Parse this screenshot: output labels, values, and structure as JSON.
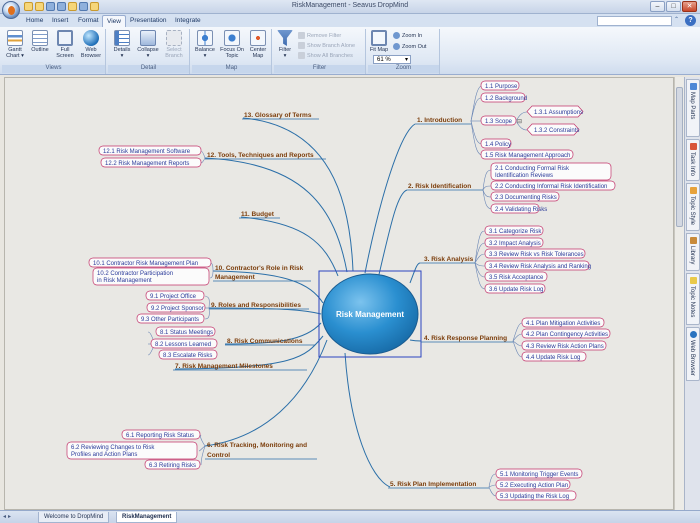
{
  "window": {
    "title": "RiskManagement - Seavus DropMind",
    "minimize": "–",
    "maximize": "□",
    "close": "✕"
  },
  "menu": {
    "tabs": [
      "Home",
      "Insert",
      "Format",
      "View",
      "Presentation",
      "Integrate"
    ],
    "active_tab": "View",
    "help": "?"
  },
  "ribbon": {
    "groups": {
      "views": {
        "label": "Views",
        "buttons": [
          {
            "label": "Gantt\nChart ▾",
            "icon": "gantt-chart-icon"
          },
          {
            "label": "Outline",
            "icon": "outline-icon"
          },
          {
            "label": "Full\nScreen",
            "icon": "full-screen-icon"
          },
          {
            "label": "Web\nBrowser",
            "icon": "web-browser-icon"
          }
        ]
      },
      "detail": {
        "label": "Detail",
        "buttons": [
          {
            "label": "Details\n▾",
            "icon": "details-icon",
            "disabled": false
          },
          {
            "label": "Collapse\n▾",
            "icon": "collapse-icon",
            "disabled": false
          },
          {
            "label": "Select\nBranch",
            "icon": "select-branch-icon",
            "disabled": true
          }
        ]
      },
      "map": {
        "label": "Map",
        "buttons": [
          {
            "label": "Balance\n▾",
            "icon": "balance-icon"
          },
          {
            "label": "Focus On\nTopic",
            "icon": "focus-on-topic-icon"
          },
          {
            "label": "Center\nMap",
            "icon": "center-map-icon"
          }
        ]
      },
      "filter": {
        "label": "Filter",
        "button": {
          "label": "Filter\n▾",
          "icon": "filter-icon"
        },
        "items": [
          "Remove Filter",
          "Show Branch Alone",
          "Show All Branches"
        ]
      },
      "zoom": {
        "label": "Zoom",
        "fit_map": "Fit Map",
        "zoom_in": "Zoom In",
        "zoom_out": "Zoom Out",
        "zoom_value": "61 %"
      }
    }
  },
  "mindmap": {
    "central": "Risk Management",
    "branches": [
      {
        "label": "1. Introduction",
        "children": [
          "1.1 Purpose",
          "1.2 Background",
          "1.3 Scope",
          "1.4 Policy",
          "1.5 Risk Management Approach"
        ],
        "subchildren": [
          "1.3.1 Assumptions",
          "1.3.2 Constraints"
        ]
      },
      {
        "label": "2. Risk Identification",
        "children": [
          "2.1 Conducting Formal Risk Identification Reviews",
          "2.2 Conducting Informal Risk Identification",
          "2.3 Documenting Risks",
          "2.4 Validating Risks"
        ]
      },
      {
        "label": "3. Risk Analysis",
        "children": [
          "3.1 Categorize Risk",
          "3.2 Impact Analysis",
          "3.3 Review Risk vs Risk Tolerances",
          "3.4 Review Risk Analysis and Ranking",
          "3.5 Risk Acceptance",
          "3.6 Update Risk Log"
        ]
      },
      {
        "label": "4. Risk Response Planning",
        "children": [
          "4.1 Plan Mitigation Activities",
          "4.2 Plan Contingency Activities",
          "4.3 Review Risk Action Plans",
          "4.4 Update Risk Log"
        ]
      },
      {
        "label": "5. Risk Plan Implementation",
        "children": [
          "5.1 Monitoring Trigger Events",
          "5.2 Executing Action Plan",
          "5.3 Updating the Risk Log"
        ]
      },
      {
        "label": "6. Risk Tracking, Monitoring and Control",
        "children": [
          "6.1 Reporting Risk Status",
          "6.2 Reviewing Changes to Risk Profiles and Action Plans",
          "6.3 Retiring Risks"
        ]
      },
      {
        "label": "7. Risk Management Milestones",
        "children": []
      },
      {
        "label": "8. Risk Communications",
        "children": [
          "8.1 Status Meetings",
          "8.2 Lessons Learned",
          "8.3 Escalate Risks"
        ]
      },
      {
        "label": "9. Roles and Responsibilities",
        "children": [
          "9.1 Project Office",
          "9.2 Project Sponsor",
          "9.3 Other Participants"
        ]
      },
      {
        "label": "10. Contractor's Role in Risk Management",
        "children": [
          "10.1 Contractor Risk Management Plan",
          "10.2 Contractor Participation in Risk Management"
        ]
      },
      {
        "label": "11. Budget",
        "children": []
      },
      {
        "label": "12. Tools, Techniques and Reports",
        "children": [
          "12.1 Risk Management Software",
          "12.2 Risk Management Reports"
        ]
      },
      {
        "label": "13. Glossary of Terms",
        "children": []
      }
    ]
  },
  "sidebar": {
    "tabs": [
      "Map Parts",
      "Task Info",
      "Topic Style",
      "Library",
      "Topic Notes",
      "Web Browser"
    ]
  },
  "statusbar": {
    "nav": "◂▸",
    "doc_tabs": [
      "Welcome to DropMind",
      "RiskManagement"
    ],
    "active_doc": "RiskManagement"
  },
  "colors": {
    "central_fill": "#1f86c8",
    "branch_line": "#2b6fa8",
    "topic_border": "#c2356b",
    "topic_text": "#2a3a9a",
    "branch_text": "#7b3d0b"
  }
}
